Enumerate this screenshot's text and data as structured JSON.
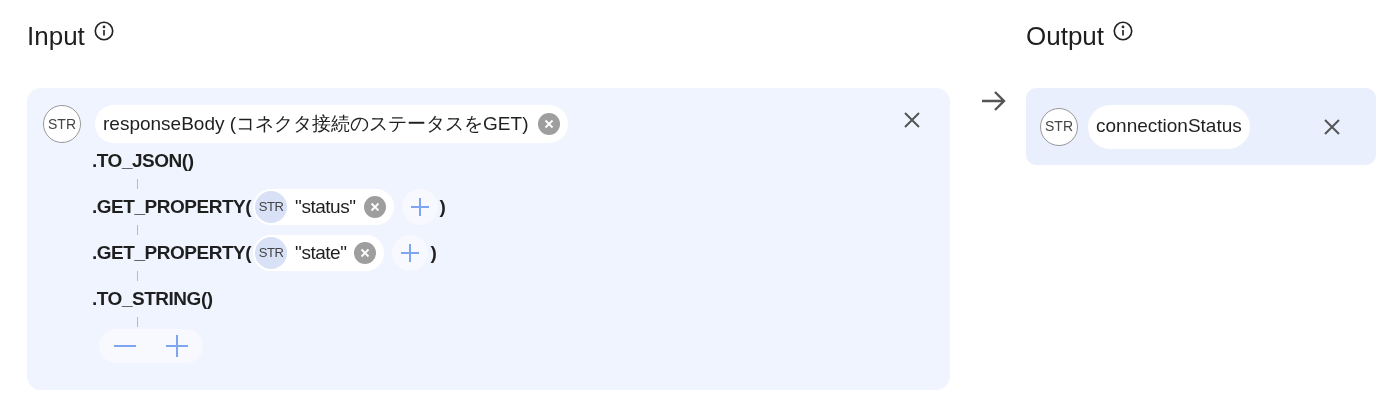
{
  "input": {
    "title": "Input",
    "variable": {
      "type": "STR",
      "name": "responseBody (コネクタ接続のステータスをGET)"
    },
    "functions": [
      {
        "kind": "plain",
        "text": ".TO_JSON()"
      },
      {
        "kind": "args",
        "open": ".GET_PROPERTY(",
        "args": [
          {
            "type": "STR",
            "value": "\"status\""
          }
        ],
        "close": ")"
      },
      {
        "kind": "args",
        "open": ".GET_PROPERTY(",
        "args": [
          {
            "type": "STR",
            "value": "\"state\""
          }
        ],
        "close": ")"
      },
      {
        "kind": "plain",
        "text": ".TO_STRING()"
      }
    ]
  },
  "output": {
    "title": "Output",
    "variable": {
      "type": "STR",
      "name": "connectionStatus"
    }
  }
}
